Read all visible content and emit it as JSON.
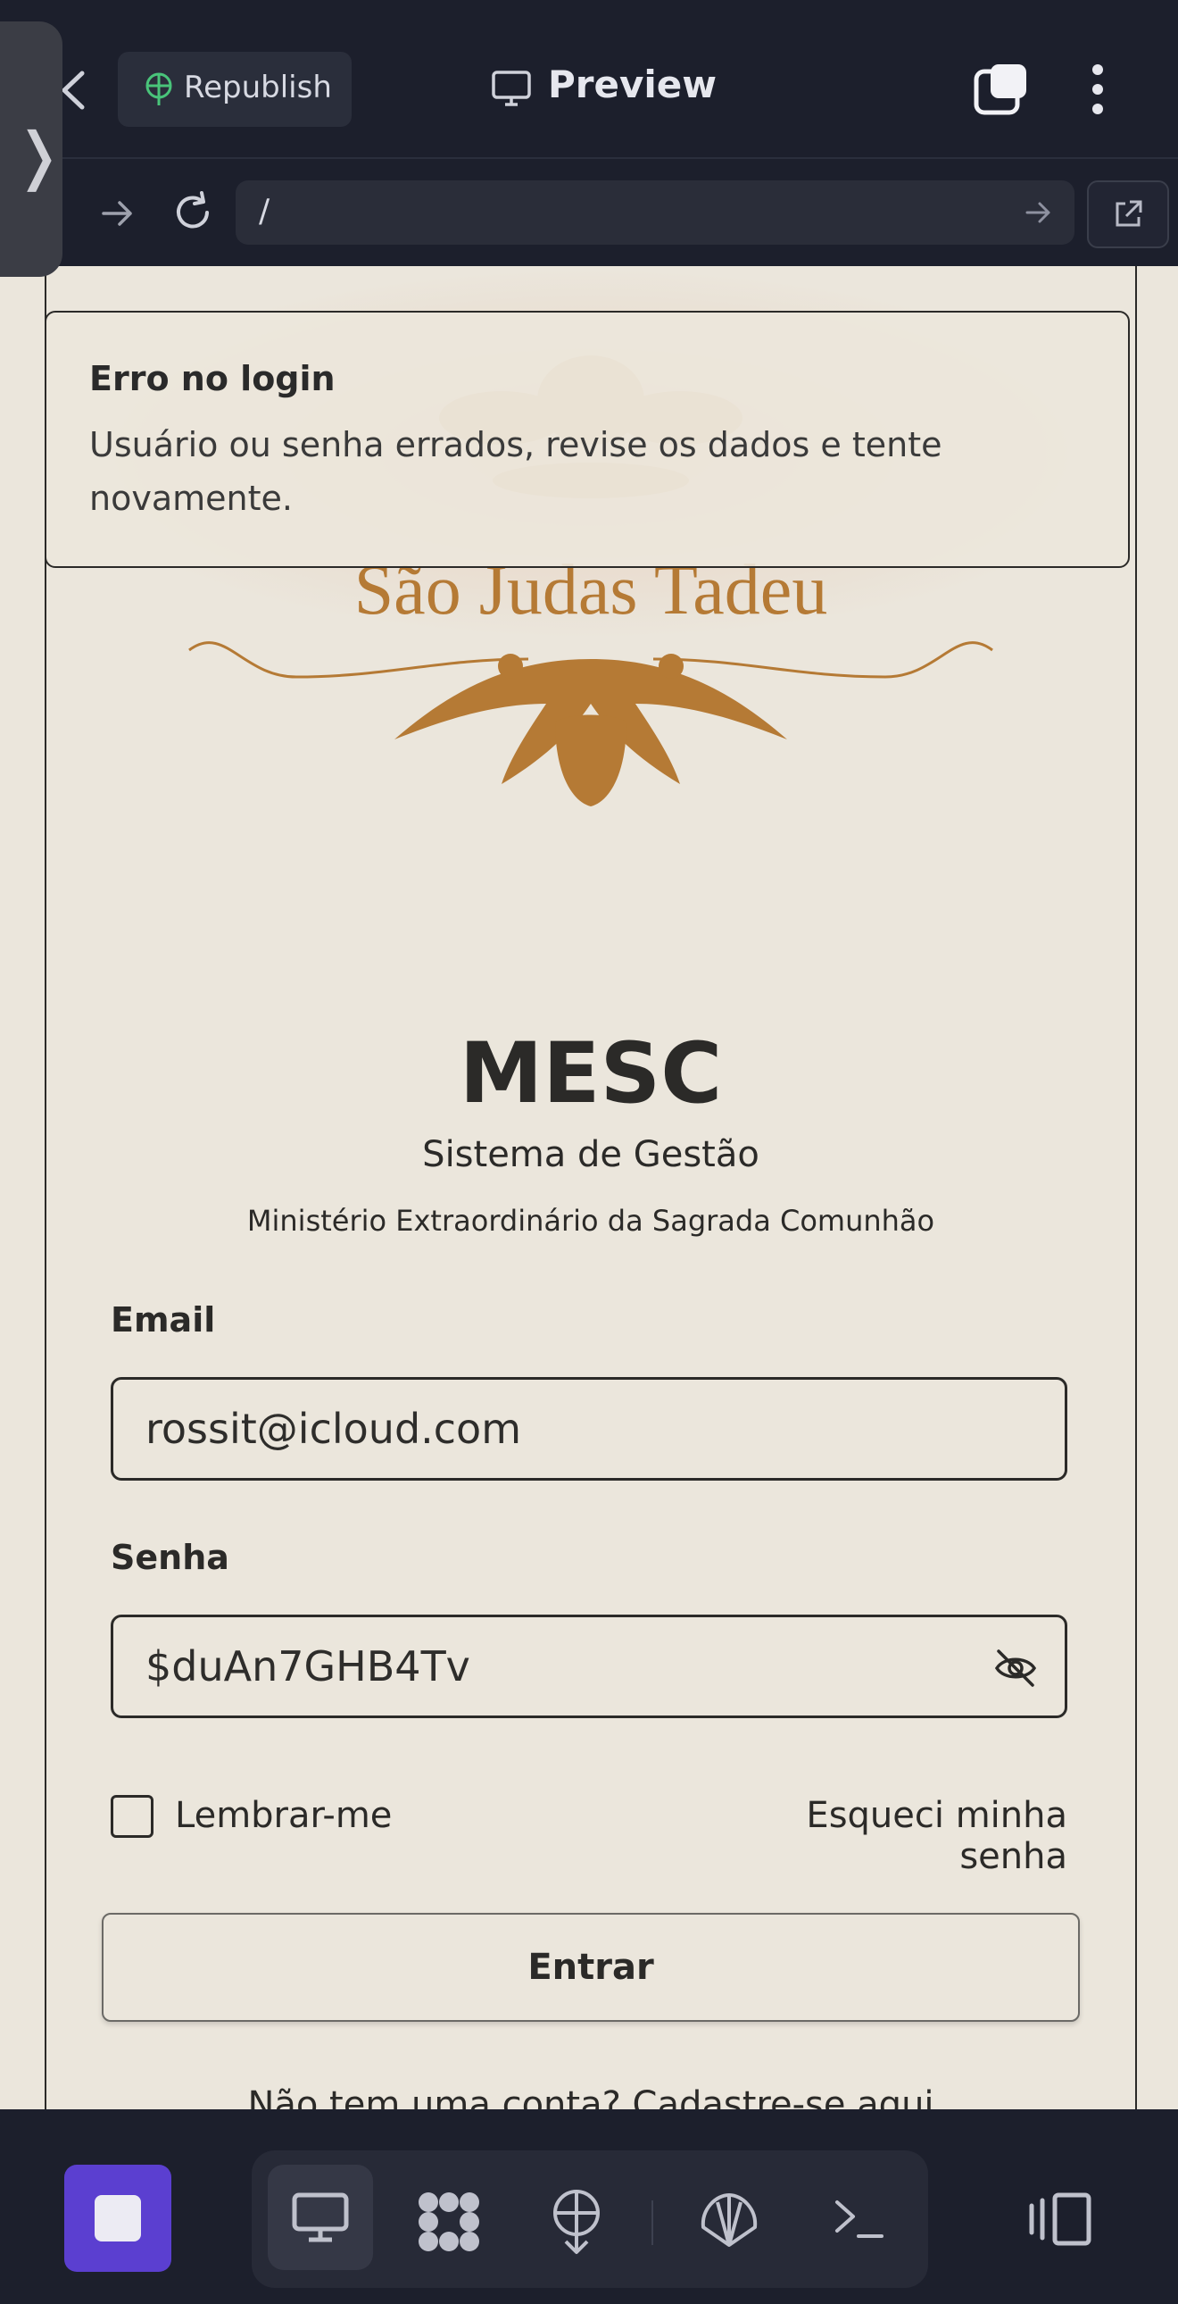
{
  "browser": {
    "republish_label": "Republish",
    "preview_label": "Preview",
    "url": "/"
  },
  "page": {
    "logo_text": "São Judas Tadeu",
    "toast": {
      "title": "Erro no login",
      "message": "Usuário ou senha errados, revise os dados e tente novamente."
    },
    "title": "MESC",
    "subtitle": "Sistema de Gestão",
    "tagline": "Ministério Extraordinário da Sagrada Comunhão",
    "email_label": "Email",
    "email_value": "rossit@icloud.com",
    "password_label": "Senha",
    "password_value": "$duAn7GHB4Tv",
    "remember_label": "Lembrar-me",
    "forgot_label": "Esqueci minha senha",
    "submit_label": "Entrar",
    "signup_text": "Não tem uma conta? Cadastre-se aqui"
  },
  "colors": {
    "accent": "#5b3fd0",
    "logo": "#b57a35",
    "background": "#ebe6dc"
  }
}
